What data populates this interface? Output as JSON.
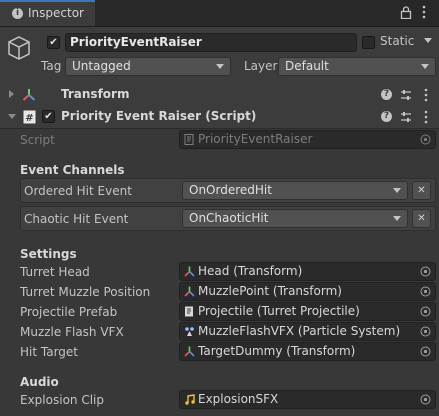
{
  "tab": {
    "label": "Inspector",
    "icon": "info-icon"
  },
  "header": {
    "object_name": "PriorityEventRaiser",
    "active": true,
    "static_label": "Static",
    "static_checked": false,
    "tag_label": "Tag",
    "tag_value": "Untagged",
    "layer_label": "Layer",
    "layer_value": "Default"
  },
  "transform": {
    "title": "Transform"
  },
  "script_component": {
    "title": "Priority Event Raiser (Script)",
    "enabled": true,
    "script_label": "Script",
    "script_value": "PriorityEventRaiser"
  },
  "event_channels": {
    "heading": "Event Channels",
    "items": [
      {
        "label": "Ordered Hit Event",
        "value": "OnOrderedHit"
      },
      {
        "label": "Chaotic Hit Event",
        "value": "OnChaoticHit"
      }
    ]
  },
  "settings": {
    "heading": "Settings",
    "fields": [
      {
        "label": "Turret Head",
        "value": "Head (Transform)",
        "icon": "transform-icon"
      },
      {
        "label": "Turret Muzzle Position",
        "value": "MuzzlePoint (Transform)",
        "icon": "transform-icon"
      },
      {
        "label": "Projectile Prefab",
        "value": "Projectile (Turret Projectile)",
        "icon": "script-file-icon"
      },
      {
        "label": "Muzzle Flash VFX",
        "value": "MuzzleFlashVFX (Particle System)",
        "icon": "particle-system-icon"
      },
      {
        "label": "Hit Target",
        "value": "TargetDummy (Transform)",
        "icon": "transform-icon"
      }
    ]
  },
  "audio": {
    "heading": "Audio",
    "fields": [
      {
        "label": "Explosion Clip",
        "value": "ExplosionSFX",
        "icon": "audio-clip-icon"
      }
    ]
  },
  "colors": {
    "accent": "#3a79bb",
    "background": "#383838",
    "field": "#2a2a2a"
  }
}
